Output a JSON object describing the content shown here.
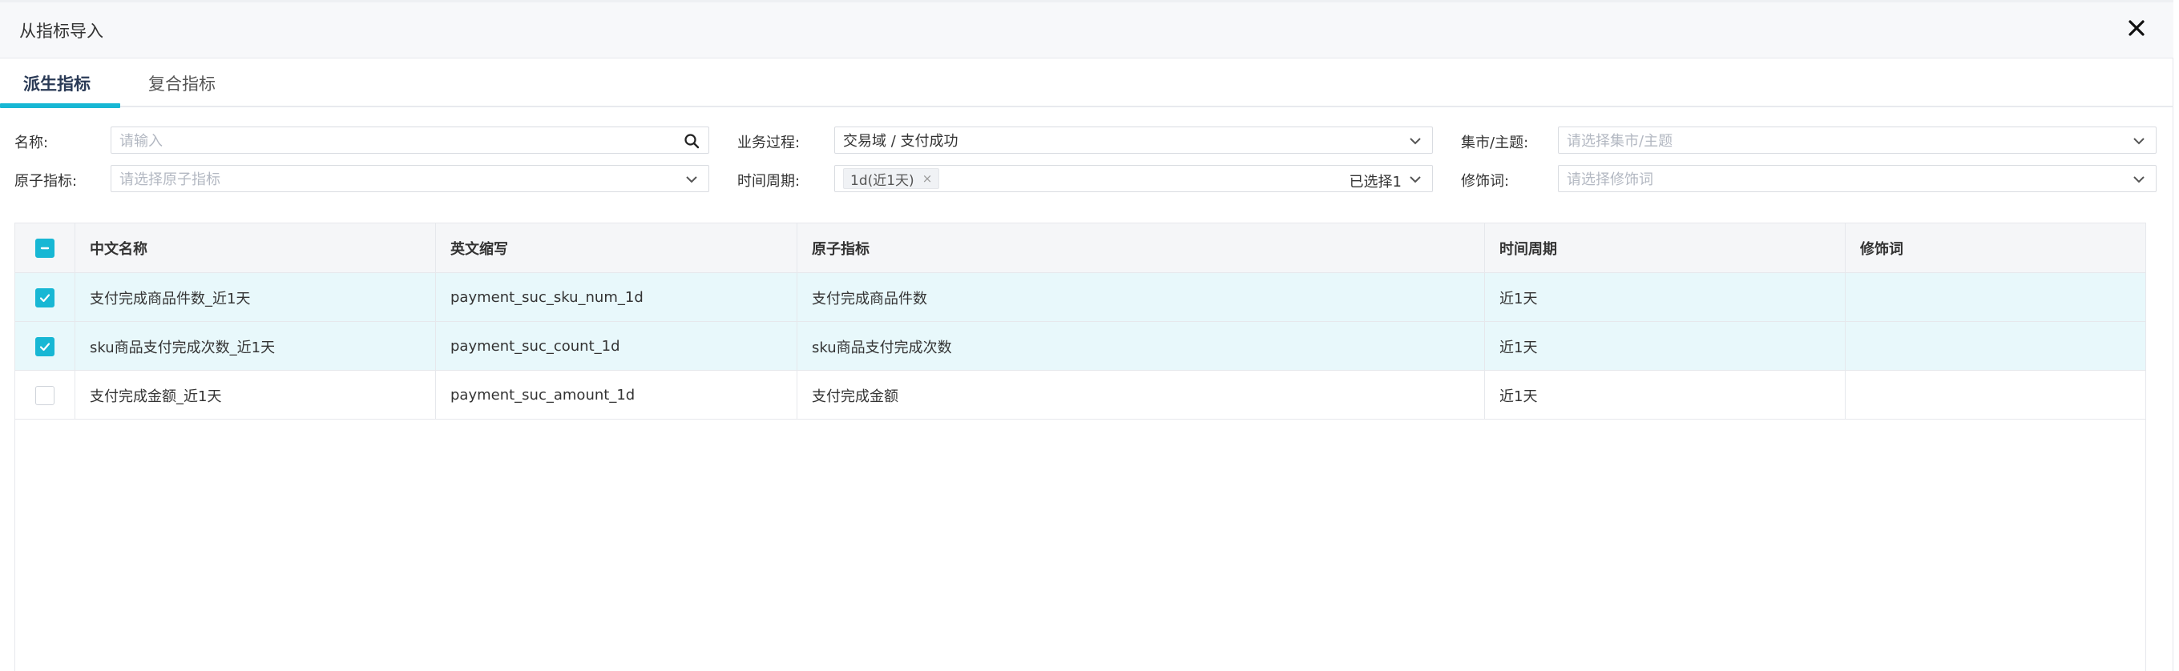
{
  "dialog": {
    "title": "从指标导入",
    "close_icon": "close-icon"
  },
  "tabs": [
    {
      "label": "派生指标",
      "active": true
    },
    {
      "label": "复合指标",
      "active": false
    }
  ],
  "filters": {
    "name": {
      "label": "名称:",
      "placeholder": "请输入",
      "icon": "search-icon"
    },
    "business_process": {
      "label": "业务过程:",
      "value": "交易域 / 支付成功",
      "icon": "chevron-down-icon"
    },
    "mart_subject": {
      "label": "集市/主题:",
      "placeholder": "请选择集市/主题",
      "icon": "chevron-down-icon"
    },
    "atomic_metric": {
      "label": "原子指标:",
      "placeholder": "请选择原子指标",
      "icon": "chevron-down-icon"
    },
    "time_period": {
      "label": "时间周期:",
      "tag": "1d(近1天)",
      "tag_close": "×",
      "selected_count": "已选择1",
      "icon": "chevron-down-icon"
    },
    "modifier": {
      "label": "修饰词:",
      "placeholder": "请选择修饰词",
      "icon": "chevron-down-icon"
    }
  },
  "table": {
    "columns": [
      "中文名称",
      "英文缩写",
      "原子指标",
      "时间周期",
      "修饰词"
    ],
    "header_checkbox": "indeterminate",
    "rows": [
      {
        "checked": true,
        "cn_name": "支付完成商品件数_近1天",
        "en_abbr": "payment_suc_sku_num_1d",
        "atomic": "支付完成商品件数",
        "period": "近1天",
        "modifier": ""
      },
      {
        "checked": true,
        "cn_name": "sku商品支付完成次数_近1天",
        "en_abbr": "payment_suc_count_1d",
        "atomic": "sku商品支付完成次数",
        "period": "近1天",
        "modifier": ""
      },
      {
        "checked": false,
        "cn_name": "支付完成金额_近1天",
        "en_abbr": "payment_suc_amount_1d",
        "atomic": "支付完成金额",
        "period": "近1天",
        "modifier": ""
      }
    ]
  },
  "colors": {
    "accent": "#17b7d4",
    "selected_row": "#e8f8fb",
    "header_bg": "#f7f8fa"
  }
}
